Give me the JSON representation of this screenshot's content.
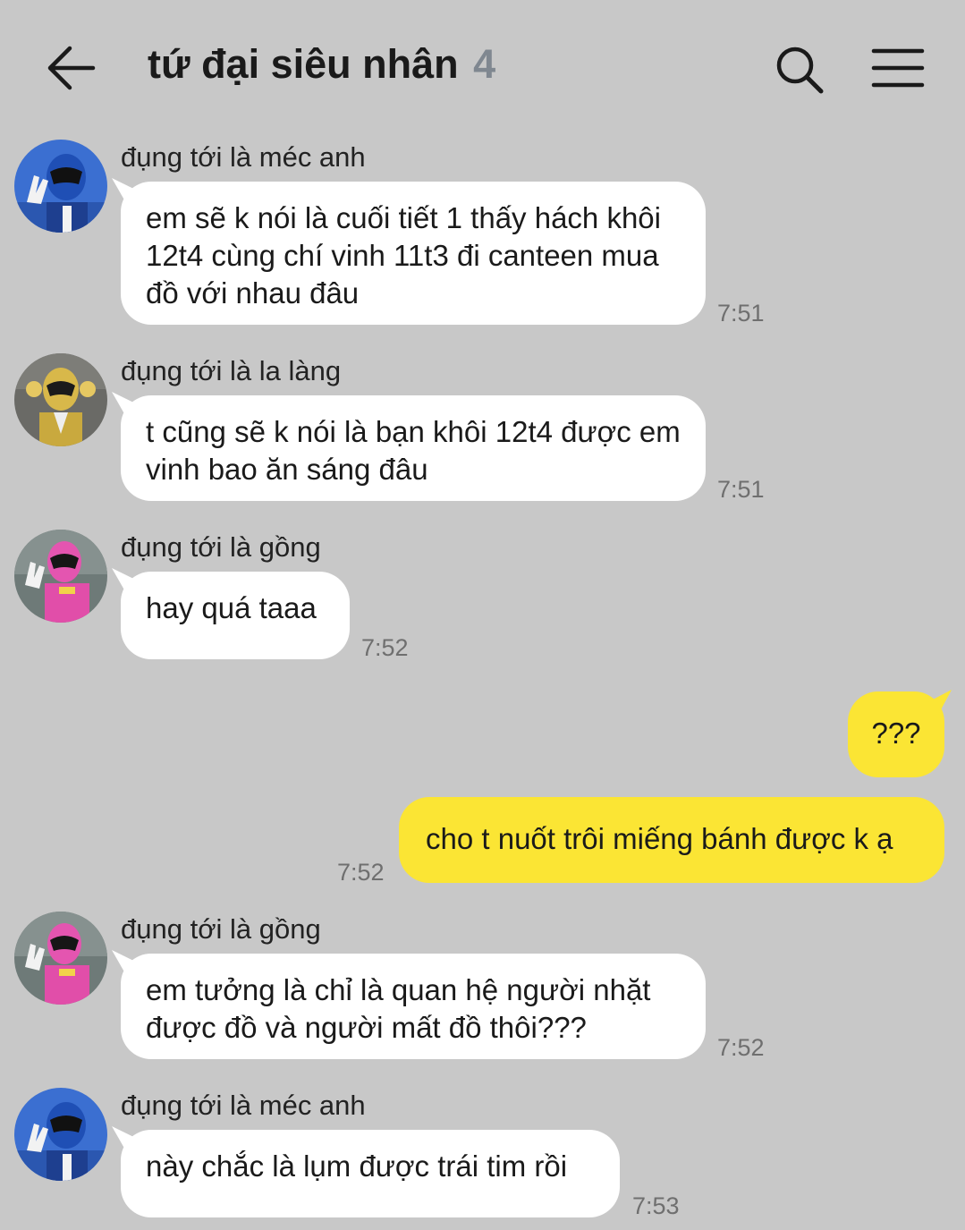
{
  "header": {
    "title": "tứ đại siêu nhân",
    "member_count": "4"
  },
  "messages": [
    {
      "sender": "đụng tới là méc anh",
      "avatar": "blue-ranger",
      "text": "em sẽ k nói là cuối tiết 1 thấy hách khôi 12t4 cùng chí vinh 11t3 đi canteen mua đồ với nhau đâu",
      "time": "7:51"
    },
    {
      "sender": "đụng tới là la làng",
      "avatar": "yellow-ranger",
      "text": "t cũng sẽ k nói là bạn khôi 12t4 được em vinh bao ăn sáng đâu",
      "time": "7:51"
    },
    {
      "sender": "đụng tới là gồng",
      "avatar": "pink-ranger",
      "text": "hay quá taaa",
      "time": "7:52"
    },
    {
      "outgoing": true,
      "text": "???"
    },
    {
      "outgoing": true,
      "text": "cho t nuốt trôi miếng bánh được k ạ",
      "time": "7:52"
    },
    {
      "sender": "đụng tới là gồng",
      "avatar": "pink-ranger",
      "text": "em tưởng là chỉ là quan hệ người nhặt được đồ và người mất đồ thôi???",
      "time": "7:52"
    },
    {
      "sender": "đụng tới là méc anh",
      "avatar": "blue-ranger",
      "text": "này chắc là lụm được trái tim rồi",
      "time": "7:53"
    }
  ],
  "colors": {
    "background": "#c8c8c8",
    "incoming_bubble": "#ffffff",
    "outgoing_bubble": "#fbe534",
    "timestamp": "#6f6f6f"
  }
}
